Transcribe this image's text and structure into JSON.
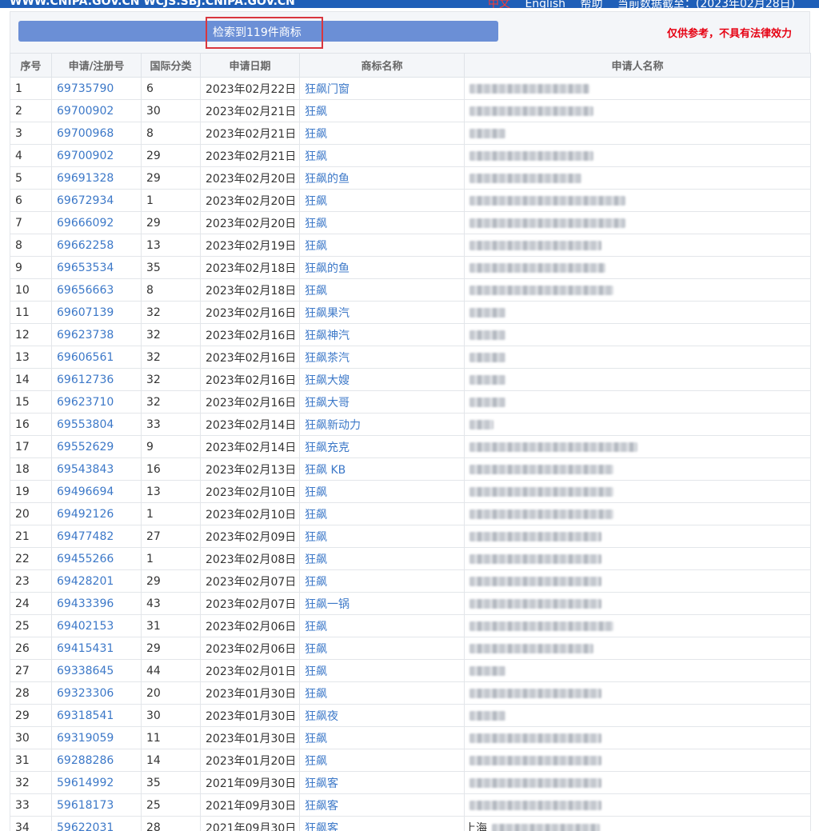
{
  "topbar": {
    "site": "WWW.CNIPA.GOV.CN  WCJS.SBJ.CNIPA.GOV.CN",
    "nav": [
      "中文",
      "English",
      "帮助",
      "当前数据截至：(2023年02月28日)"
    ]
  },
  "result": {
    "label": "检索到119件商标"
  },
  "disclaimer": "仅供参考，不具有法律效力",
  "table": {
    "headers": [
      "序号",
      "申请/注册号",
      "国际分类",
      "申请日期",
      "商标名称",
      "申请人名称"
    ],
    "rows": [
      [
        "1",
        "69735790",
        "6",
        "2023年02月22日",
        "狂飙门窗"
      ],
      [
        "2",
        "69700902",
        "30",
        "2023年02月21日",
        "狂飙"
      ],
      [
        "3",
        "69700968",
        "8",
        "2023年02月21日",
        "狂飙"
      ],
      [
        "4",
        "69700902",
        "29",
        "2023年02月21日",
        "狂飙"
      ],
      [
        "5",
        "69691328",
        "29",
        "2023年02月20日",
        "狂飙的鱼"
      ],
      [
        "6",
        "69672934",
        "1",
        "2023年02月20日",
        "狂飙"
      ],
      [
        "7",
        "69666092",
        "29",
        "2023年02月20日",
        "狂飙"
      ],
      [
        "8",
        "69662258",
        "13",
        "2023年02月19日",
        "狂飙"
      ],
      [
        "9",
        "69653534",
        "35",
        "2023年02月18日",
        "狂飙的鱼"
      ],
      [
        "10",
        "69656663",
        "8",
        "2023年02月18日",
        "狂飙"
      ],
      [
        "11",
        "69607139",
        "32",
        "2023年02月16日",
        "狂飙果汽"
      ],
      [
        "12",
        "69623738",
        "32",
        "2023年02月16日",
        "狂飙神汽"
      ],
      [
        "13",
        "69606561",
        "32",
        "2023年02月16日",
        "狂飙茶汽"
      ],
      [
        "14",
        "69612736",
        "32",
        "2023年02月16日",
        "狂飙大嫂"
      ],
      [
        "15",
        "69623710",
        "32",
        "2023年02月16日",
        "狂飙大哥"
      ],
      [
        "16",
        "69553804",
        "33",
        "2023年02月14日",
        "狂飙新动力"
      ],
      [
        "17",
        "69552629",
        "9",
        "2023年02月14日",
        "狂飙充克"
      ],
      [
        "18",
        "69543843",
        "16",
        "2023年02月13日",
        "狂飙 KB"
      ],
      [
        "19",
        "69496694",
        "13",
        "2023年02月10日",
        "狂飙"
      ],
      [
        "20",
        "69492126",
        "1",
        "2023年02月10日",
        "狂飙"
      ],
      [
        "21",
        "69477482",
        "27",
        "2023年02月09日",
        "狂飙"
      ],
      [
        "22",
        "69455266",
        "1",
        "2023年02月08日",
        "狂飙"
      ],
      [
        "23",
        "69428201",
        "29",
        "2023年02月07日",
        "狂飙"
      ],
      [
        "24",
        "69433396",
        "43",
        "2023年02月07日",
        "狂飙一锅"
      ],
      [
        "25",
        "69402153",
        "31",
        "2023年02月06日",
        "狂飙"
      ],
      [
        "26",
        "69415431",
        "29",
        "2023年02月06日",
        "狂飙"
      ],
      [
        "27",
        "69338645",
        "44",
        "2023年02月01日",
        "狂飙"
      ],
      [
        "28",
        "69323306",
        "20",
        "2023年01月30日",
        "狂飙"
      ],
      [
        "29",
        "69318541",
        "30",
        "2023年01月30日",
        "狂飙夜"
      ],
      [
        "30",
        "69319059",
        "11",
        "2023年01月30日",
        "狂飙"
      ],
      [
        "31",
        "69288286",
        "14",
        "2023年01月20日",
        "狂飙"
      ],
      [
        "32",
        "59614992",
        "35",
        "2021年09月30日",
        "狂飙客"
      ],
      [
        "33",
        "59618173",
        "25",
        "2021年09月30日",
        "狂飙客"
      ],
      [
        "34",
        "59622031",
        "28",
        "2021年09月30日",
        "狂飙客"
      ]
    ],
    "last_applicant_partial": "上海"
  },
  "colors": {
    "link": "#3c78c8",
    "bar": "#6b8fd6",
    "warning": "#e60012",
    "header_bg": "#f4f6f9"
  }
}
